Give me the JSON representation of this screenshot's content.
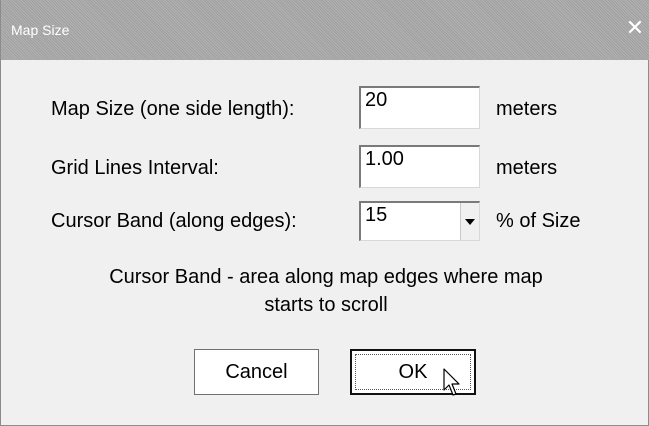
{
  "window": {
    "title": "Map Size",
    "close_glyph": "✕"
  },
  "form": {
    "map_size": {
      "label": "Map Size (one side length):",
      "value": "20",
      "unit": "meters"
    },
    "grid_interval": {
      "label": "Grid Lines Interval:",
      "value": "1.00",
      "unit": "meters"
    },
    "cursor_band": {
      "label": "Cursor Band (along edges):",
      "value": "15",
      "unit": "% of Size"
    }
  },
  "info_line1": "Cursor Band - area along map edges where map",
  "info_line2": "starts to scroll",
  "buttons": {
    "cancel": "Cancel",
    "ok": "OK"
  },
  "icons": {
    "close": "close-icon",
    "dropdown": "chevron-down-icon",
    "cursor": "mouse-pointer-icon"
  },
  "colors": {
    "titlebar": "#a9a9a9",
    "dialog_bg": "#f0f0f0",
    "field_bg": "#ffffff"
  }
}
